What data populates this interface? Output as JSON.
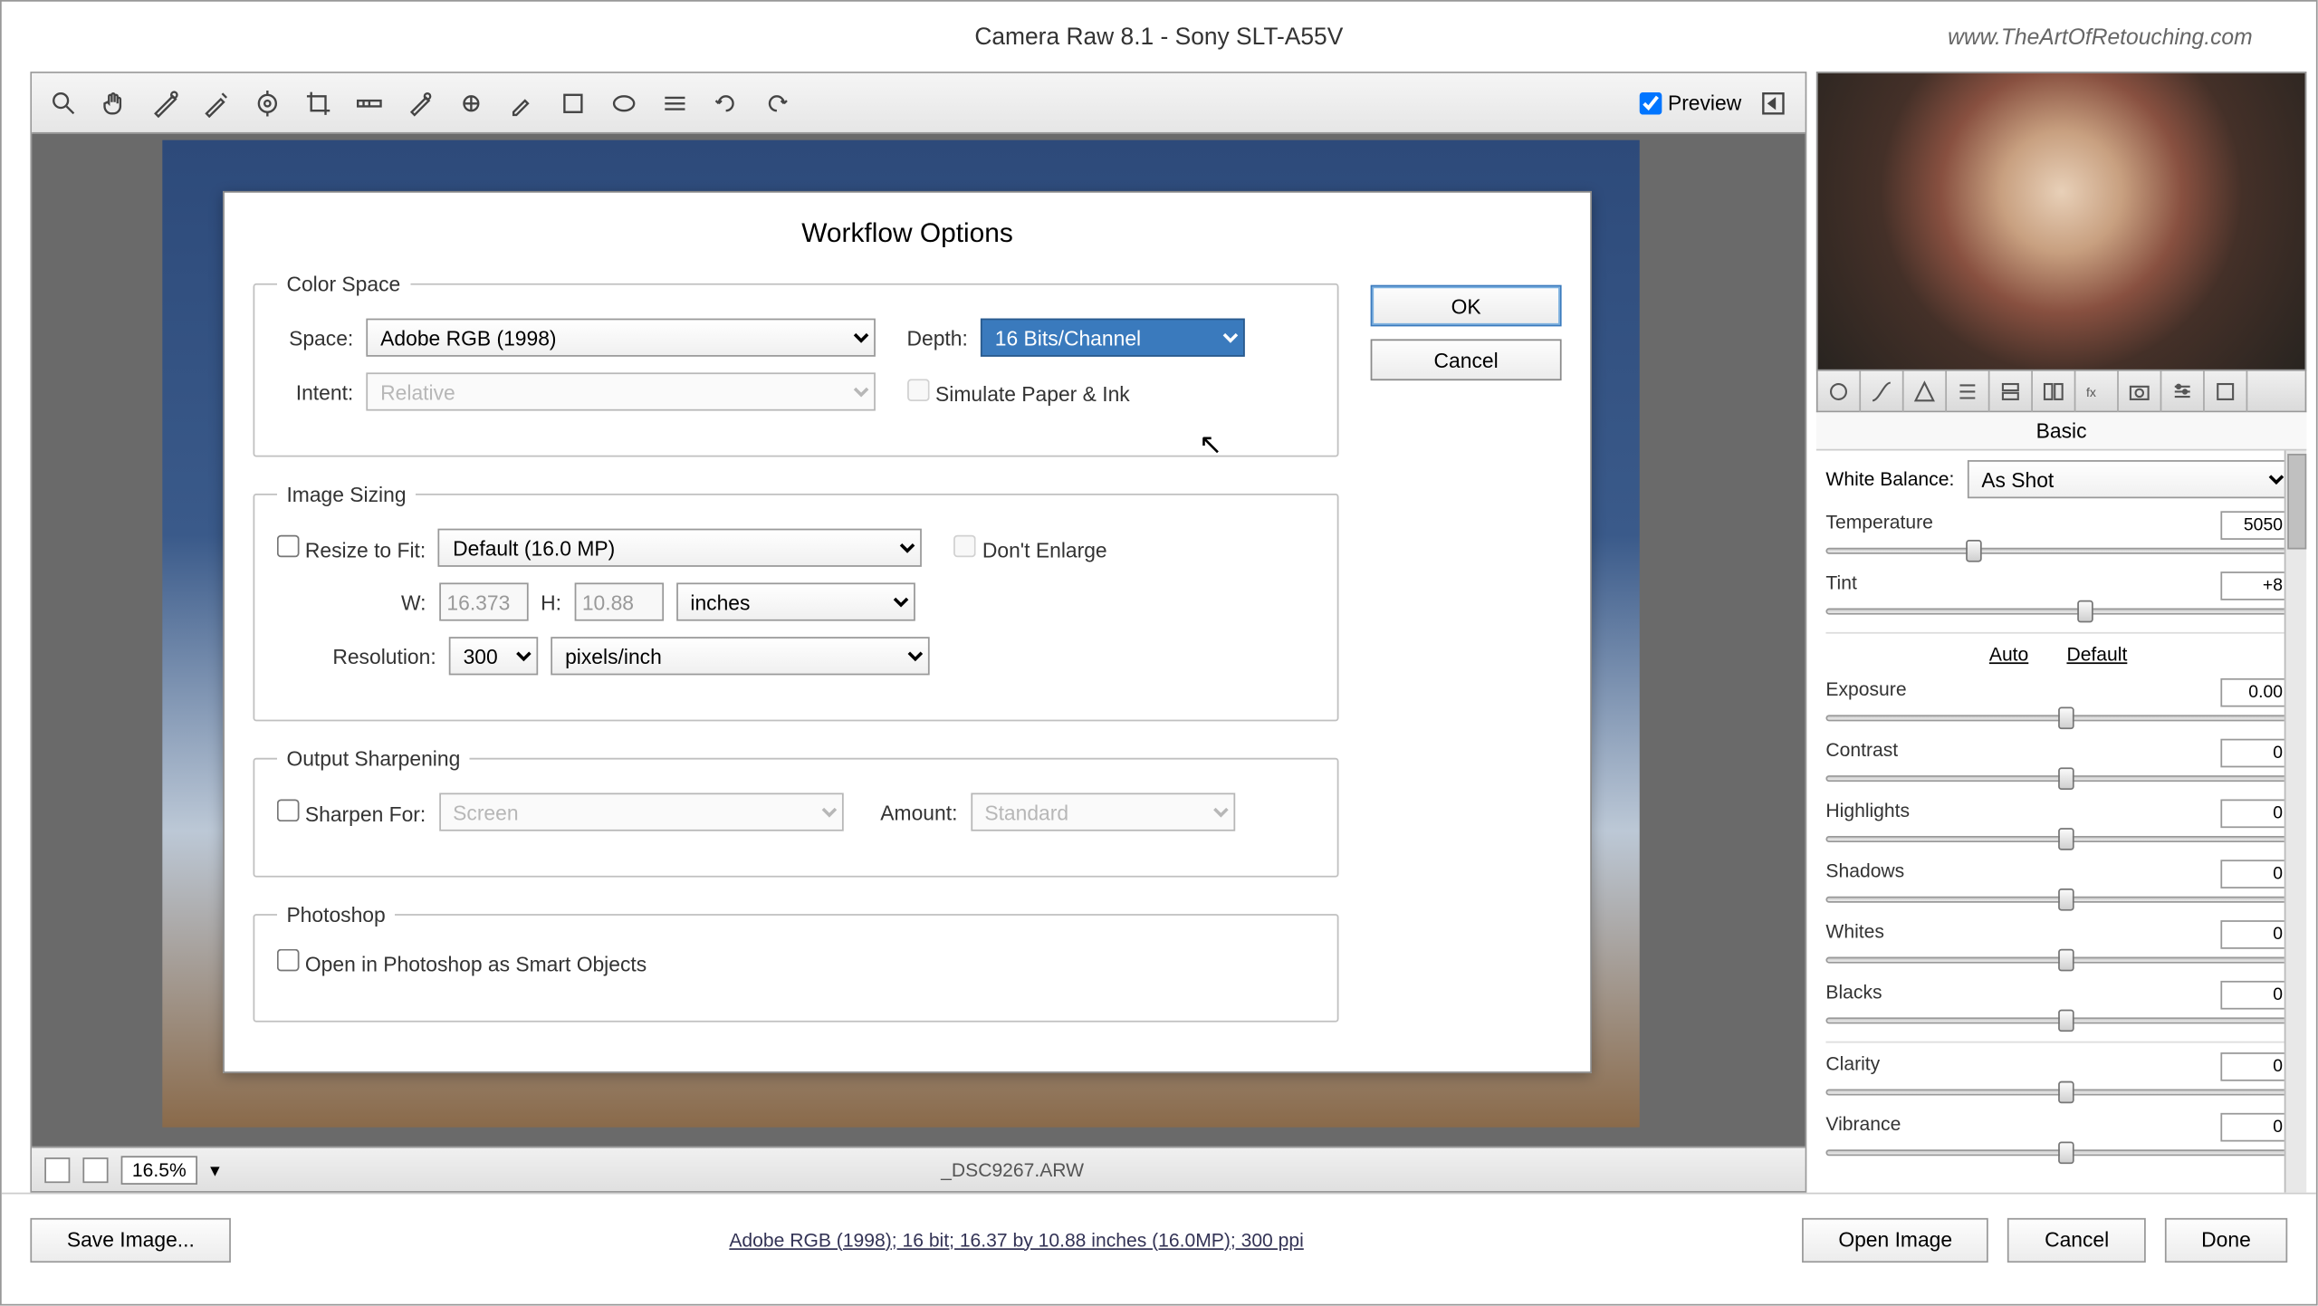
{
  "title": "Camera Raw 8.1  -  Sony SLT-A55V",
  "watermark": "www.TheArtOfRetouching.com",
  "preview_label": "Preview",
  "dialog": {
    "title": "Workflow Options",
    "ok": "OK",
    "cancel": "Cancel",
    "colorspace": {
      "legend": "Color Space",
      "space_label": "Space:",
      "space_value": "Adobe RGB (1998)",
      "depth_label": "Depth:",
      "depth_value": "16 Bits/Channel",
      "intent_label": "Intent:",
      "intent_value": "Relative",
      "simulate_label": "Simulate Paper & Ink"
    },
    "sizing": {
      "legend": "Image Sizing",
      "resize_label": "Resize to Fit:",
      "resize_value": "Default  (16.0 MP)",
      "dont_enlarge": "Don't Enlarge",
      "w_label": "W:",
      "w_value": "16.373",
      "h_label": "H:",
      "h_value": "10.88",
      "unit_value": "inches",
      "res_label": "Resolution:",
      "res_value": "300",
      "res_unit": "pixels/inch"
    },
    "sharpen": {
      "legend": "Output Sharpening",
      "sharpen_label": "Sharpen For:",
      "sharpen_value": "Screen",
      "amount_label": "Amount:",
      "amount_value": "Standard"
    },
    "ps": {
      "legend": "Photoshop",
      "smart_label": "Open in Photoshop as Smart Objects"
    }
  },
  "status": {
    "zoom": "16.5%",
    "filename": "_DSC9267.ARW"
  },
  "panel": {
    "title": "Basic",
    "wb_label": "White Balance:",
    "wb_value": "As Shot",
    "auto": "Auto",
    "default": "Default",
    "adjustments": [
      {
        "name": "Temperature",
        "value": "5050",
        "pos": 30
      },
      {
        "name": "Tint",
        "value": "+8",
        "pos": 54
      },
      {
        "name": "Exposure",
        "value": "0.00",
        "pos": 50
      },
      {
        "name": "Contrast",
        "value": "0",
        "pos": 50
      },
      {
        "name": "Highlights",
        "value": "0",
        "pos": 50
      },
      {
        "name": "Shadows",
        "value": "0",
        "pos": 50
      },
      {
        "name": "Whites",
        "value": "0",
        "pos": 50
      },
      {
        "name": "Blacks",
        "value": "0",
        "pos": 50
      },
      {
        "name": "Clarity",
        "value": "0",
        "pos": 50
      },
      {
        "name": "Vibrance",
        "value": "0",
        "pos": 50
      }
    ]
  },
  "bottom": {
    "save": "Save Image...",
    "info": "Adobe RGB (1998); 16 bit; 16.37 by 10.88 inches (16.0MP); 300 ppi",
    "open": "Open Image",
    "cancel": "Cancel",
    "done": "Done"
  }
}
